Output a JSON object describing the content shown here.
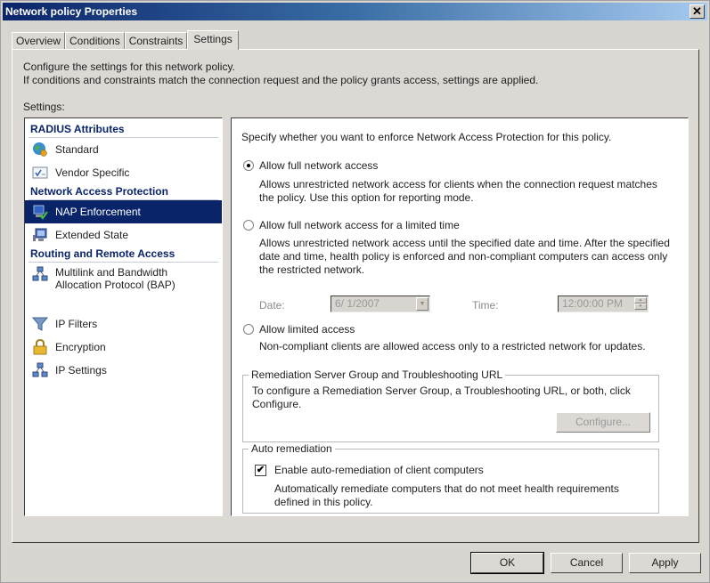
{
  "window": {
    "title": "Network policy Properties",
    "close_glyph": "✕"
  },
  "tabs": [
    {
      "label": "Overview",
      "active": false
    },
    {
      "label": "Conditions",
      "active": false
    },
    {
      "label": "Constraints",
      "active": false
    },
    {
      "label": "Settings",
      "active": true
    }
  ],
  "intro": {
    "line1": "Configure the settings for this network policy.",
    "line2": "If conditions and constraints match the connection request and the policy grants access, settings are applied."
  },
  "settings_label": "Settings:",
  "nav": {
    "groups": [
      {
        "title": "RADIUS Attributes",
        "items": [
          {
            "label": "Standard",
            "icon": "globe-icon"
          },
          {
            "label": "Vendor Specific",
            "icon": "checkbox-window-icon"
          }
        ]
      },
      {
        "title": "Network Access Protection",
        "items": [
          {
            "label": "NAP Enforcement",
            "icon": "nap-computer-icon",
            "selected": true
          },
          {
            "label": "Extended State",
            "icon": "monitor-icon"
          }
        ]
      },
      {
        "title": "Routing and Remote Access",
        "items": [
          {
            "label": "Multilink and Bandwidth Allocation Protocol (BAP)",
            "icon": "network-icon"
          },
          {
            "label": "IP Filters",
            "icon": "funnel-icon"
          },
          {
            "label": "Encryption",
            "icon": "lock-icon"
          },
          {
            "label": "IP Settings",
            "icon": "network-icon"
          }
        ]
      }
    ]
  },
  "content": {
    "heading": "Specify whether you want to enforce Network Access Protection for this policy.",
    "options": [
      {
        "label": "Allow full network access",
        "checked": true,
        "description": "Allows unrestricted network access for clients when the connection request matches the policy.  Use this option for reporting mode."
      },
      {
        "label": "Allow full network access for a limited time",
        "checked": false,
        "description": "Allows unrestricted network access until the specified date and time. After the specified date and time, health policy is enforced and non-compliant computers can access only the restricted network."
      },
      {
        "label": "Allow limited access",
        "checked": false,
        "description": "Non-compliant clients are allowed access only to a restricted network for updates."
      }
    ],
    "date_label": "Date:",
    "date_value": "6/ 1/2007",
    "time_label": "Time:",
    "time_value": "12:00:00 PM",
    "remediation": {
      "legend": "Remediation Server Group and Troubleshooting URL",
      "text": "To configure a Remediation Server Group, a Troubleshooting URL, or both, click Configure.",
      "configure_label": "Configure..."
    },
    "auto_remediation": {
      "legend": "Auto remediation",
      "checkbox_label": "Enable auto-remediation of client computers",
      "checked": true,
      "check_glyph": "✔",
      "description": "Automatically remediate computers that do not meet health requirements defined in this policy."
    }
  },
  "footer": {
    "ok_label": "OK",
    "cancel_label": "Cancel",
    "apply_label": "Apply"
  },
  "colors": {
    "selection": "#0a246a",
    "group_heading": "#0a246a"
  }
}
